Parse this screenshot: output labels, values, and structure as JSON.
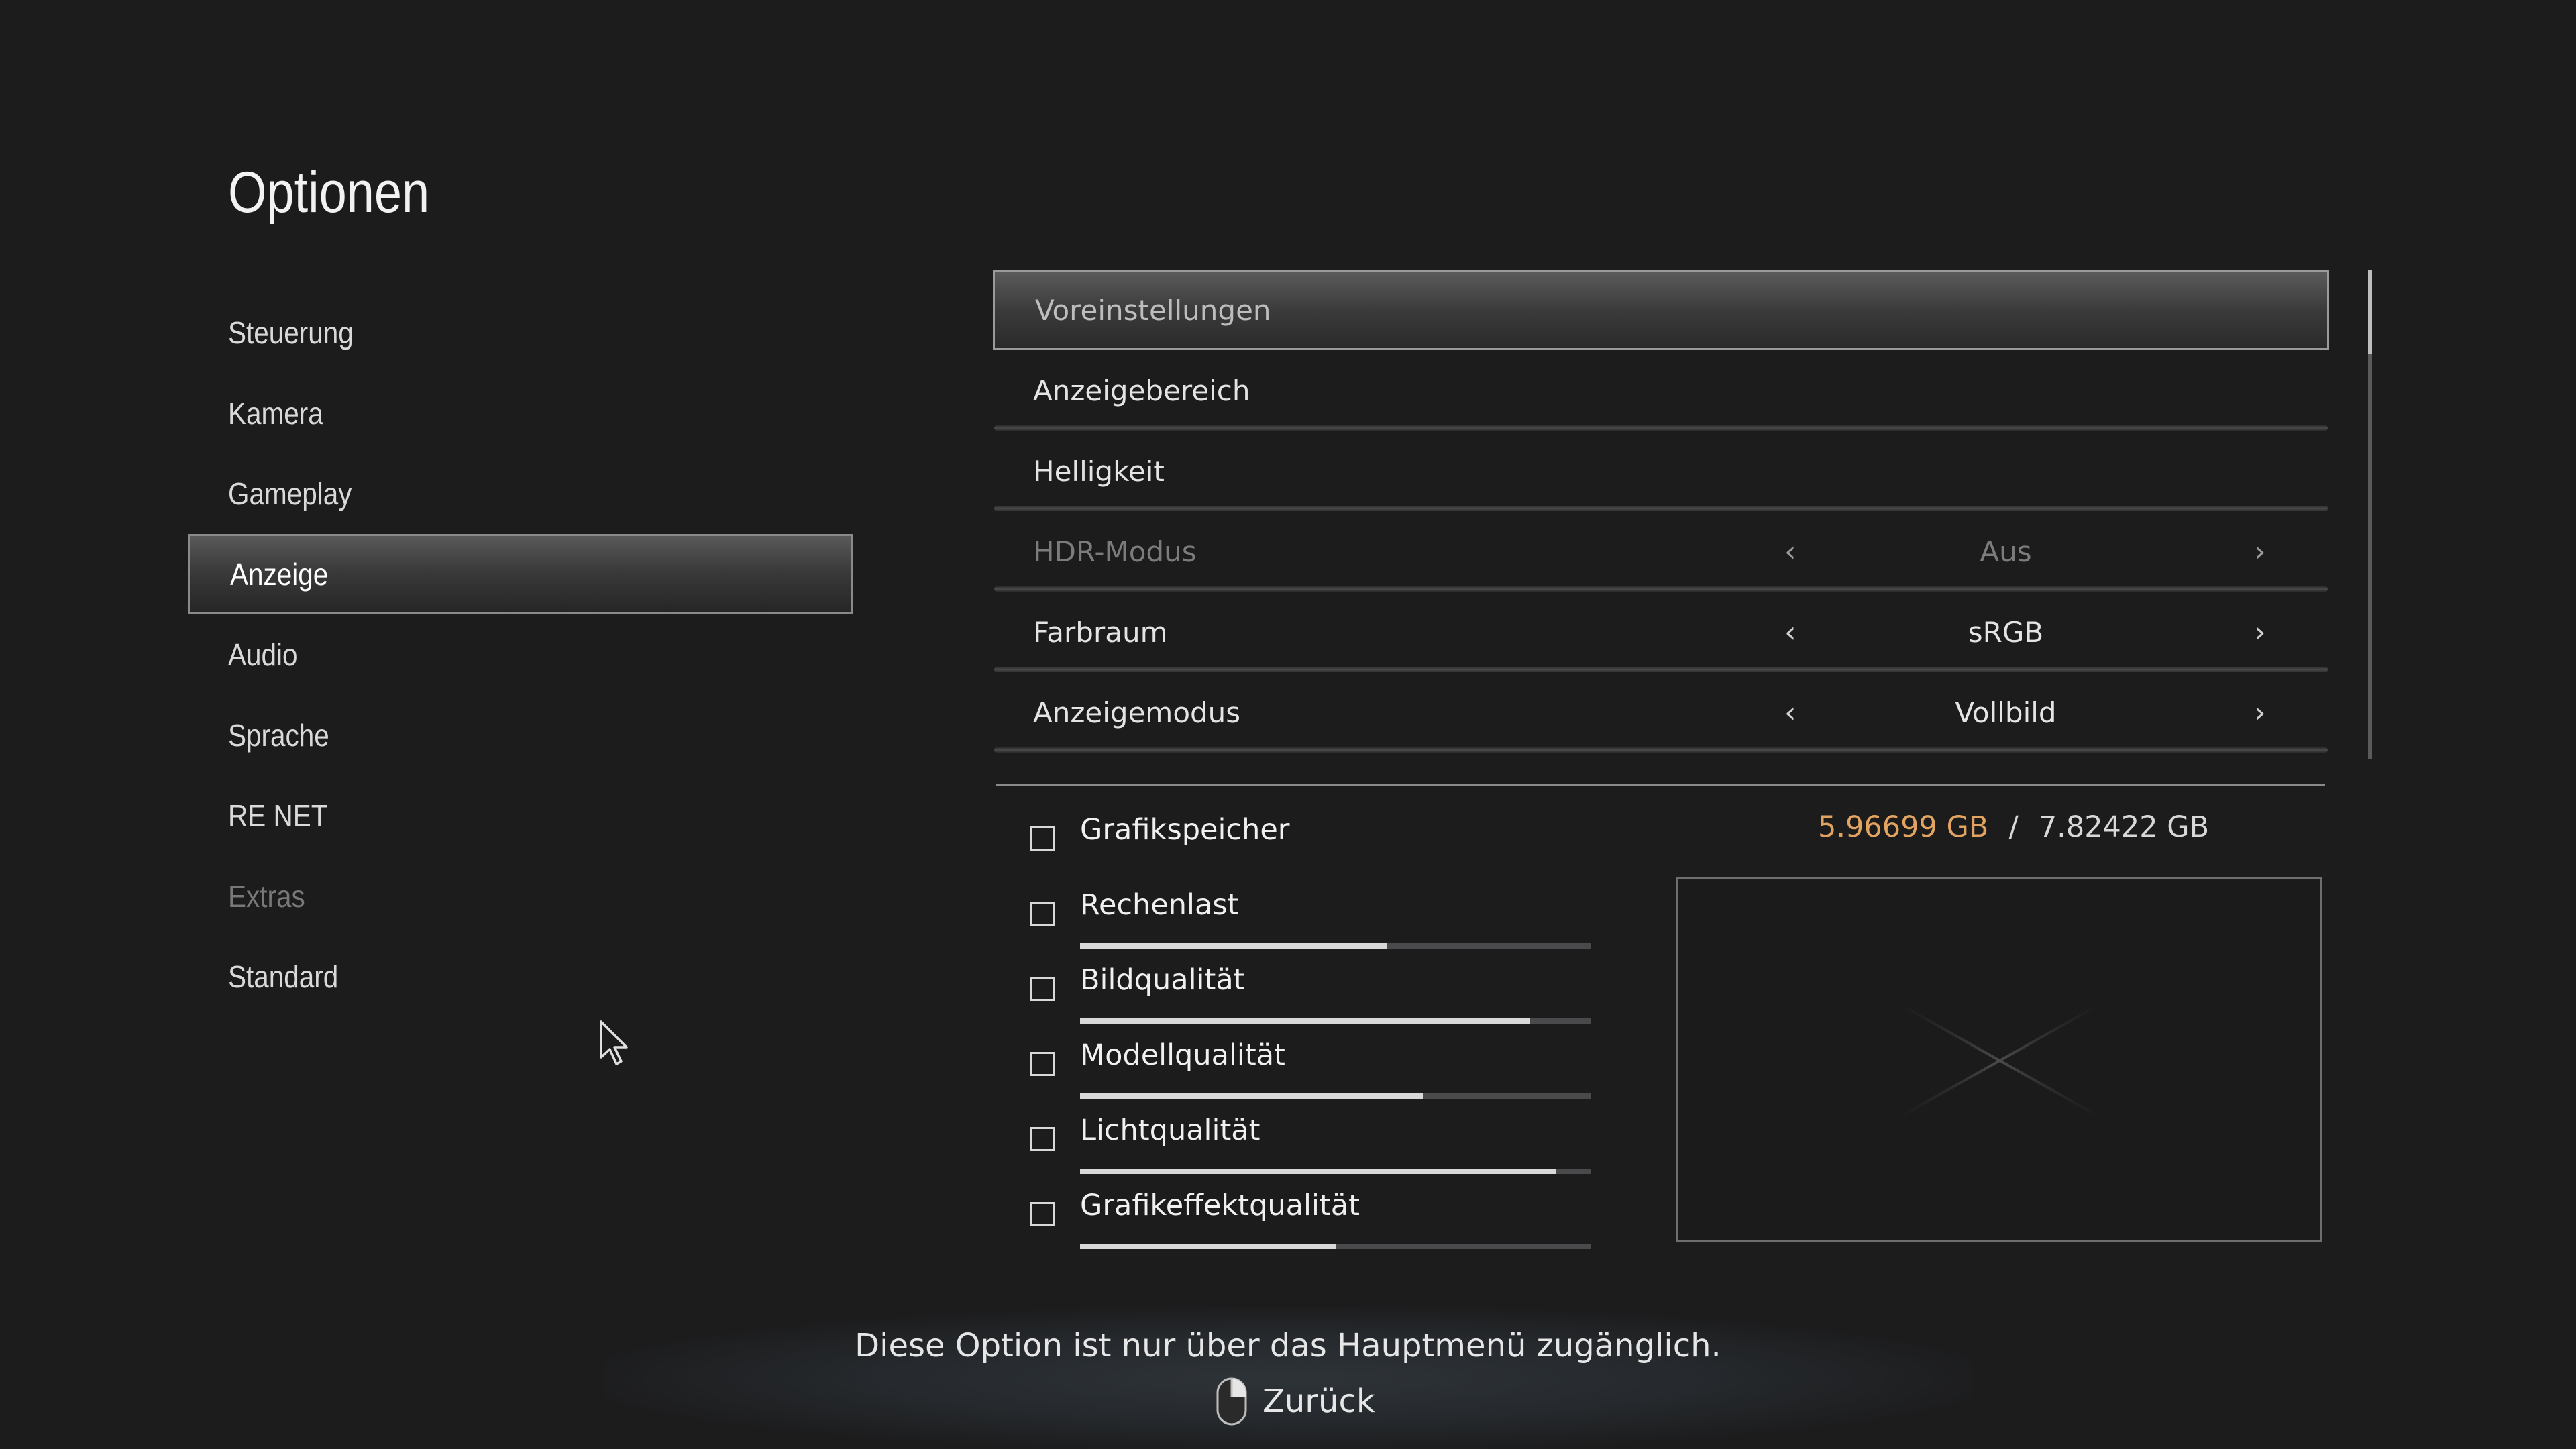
{
  "page_title": "Optionen",
  "menu": {
    "items": [
      {
        "label": "Steuerung",
        "state": "normal"
      },
      {
        "label": "Kamera",
        "state": "normal"
      },
      {
        "label": "Gameplay",
        "state": "normal"
      },
      {
        "label": "Anzeige",
        "state": "active"
      },
      {
        "label": "Audio",
        "state": "normal"
      },
      {
        "label": "Sprache",
        "state": "normal"
      },
      {
        "label": "RE NET",
        "state": "normal"
      },
      {
        "label": "Extras",
        "state": "disabled"
      },
      {
        "label": "Standard",
        "state": "normal"
      }
    ]
  },
  "settings": {
    "rows": [
      {
        "label": "Voreinstellungen"
      },
      {
        "label": "Anzeigebereich"
      },
      {
        "label": "Helligkeit"
      },
      {
        "label": "HDR-Modus",
        "value": "Aus"
      },
      {
        "label": "Farbraum",
        "value": "sRGB"
      },
      {
        "label": "Anzeigemodus",
        "value": "Vollbild"
      }
    ]
  },
  "graphics": {
    "memory_label": "Grafikspeicher",
    "memory_used": "5.96699 GB",
    "memory_separator": "/",
    "memory_total": "7.82422 GB",
    "items": [
      {
        "label": "Rechenlast",
        "level": 0.6
      },
      {
        "label": "Bildqualität",
        "level": 0.88
      },
      {
        "label": "Modellqualität",
        "level": 0.67
      },
      {
        "label": "Lichtqualität",
        "level": 0.93
      },
      {
        "label": "Grafikeffektqualität",
        "level": 0.5
      }
    ]
  },
  "footer": {
    "message": "Diese Option ist nur über das Hauptmenü zugänglich.",
    "back_label": "Zurück"
  },
  "colors": {
    "background": "#1c1c1d",
    "memory_used": "#e3a462",
    "disabled_text": "#77787a"
  },
  "icons": {
    "back": "mouse-right-click-icon",
    "pointer": "mouse-cursor-icon"
  }
}
